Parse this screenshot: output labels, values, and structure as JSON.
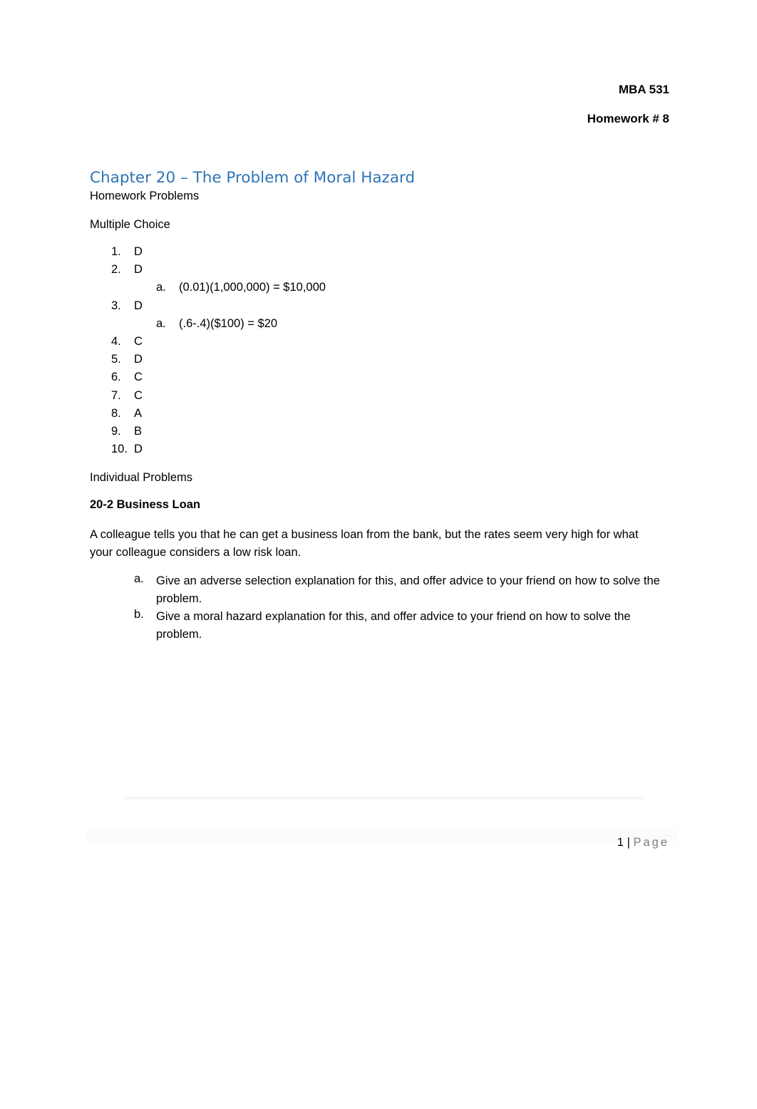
{
  "header": {
    "course": "MBA 531",
    "assignment": "Homework # 8"
  },
  "title": "Chapter 20 – The Problem of Moral Hazard",
  "subtitle": "Homework Problems",
  "multiple_choice": {
    "heading": "Multiple Choice",
    "answers": [
      {
        "num": "1.",
        "answer": "D"
      },
      {
        "num": "2.",
        "answer": "D",
        "sub_label": "a.",
        "sub_text": "(0.01)(1,000,000) = $10,000"
      },
      {
        "num": "3.",
        "answer": "D",
        "sub_label": "a.",
        "sub_text": "(.6-.4)($100) = $20"
      },
      {
        "num": "4.",
        "answer": "C"
      },
      {
        "num": "5.",
        "answer": "D"
      },
      {
        "num": "6.",
        "answer": "C"
      },
      {
        "num": "7.",
        "answer": "C"
      },
      {
        "num": "8.",
        "answer": "A"
      },
      {
        "num": "9.",
        "answer": "B"
      },
      {
        "num": "10.",
        "answer": "D"
      }
    ]
  },
  "individual": {
    "heading": "Individual Problems",
    "problem_title": "20-2 Business Loan",
    "prompt": "A colleague tells you that he can get a business loan from the bank, but the rates seem very high for what your colleague considers a low risk loan.",
    "parts": [
      {
        "label": "a.",
        "text": "Give an adverse selection explanation for this, and offer advice to your friend on how to solve the problem."
      },
      {
        "label": "b.",
        "text": "Give a moral hazard explanation for this, and offer advice to your friend on how to solve the problem."
      }
    ]
  },
  "footer": {
    "page_number": "1",
    "separator": "|",
    "page_word": "Page"
  }
}
